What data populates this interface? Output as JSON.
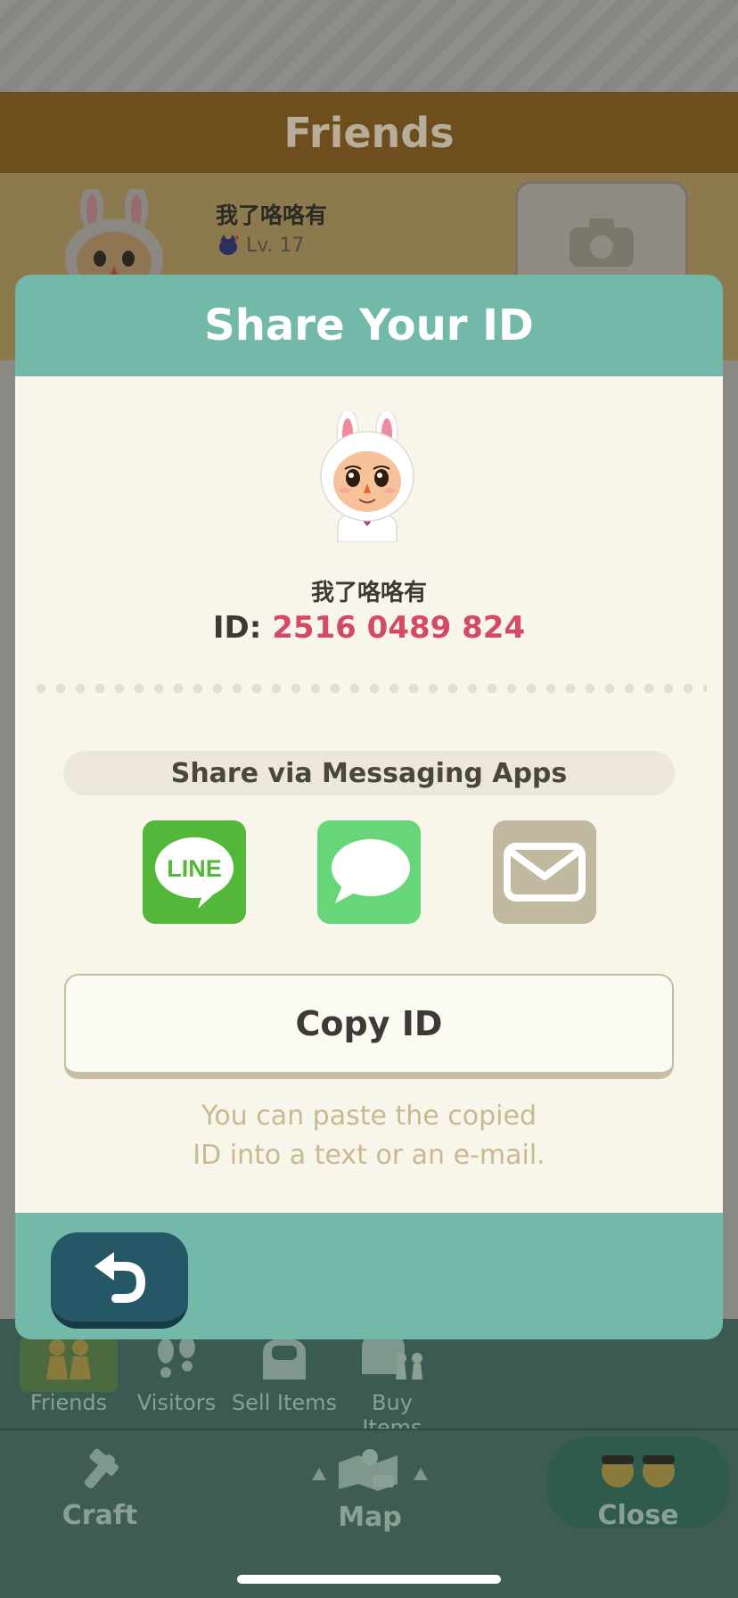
{
  "background": {
    "header_title": "Friends",
    "friend": {
      "name": "我了咯咯有",
      "level": "Lv. 17"
    },
    "tabs": [
      {
        "label": "Friends",
        "icon": "friends-icon",
        "active": true
      },
      {
        "label": "Visitors",
        "icon": "footprints-icon",
        "active": false
      },
      {
        "label": "Sell Items",
        "icon": "sell-box-icon",
        "active": false
      },
      {
        "label": "Buy Items",
        "icon": "buy-box-icon",
        "active": false
      }
    ],
    "bottom_nav": {
      "craft": "Craft",
      "map": "Map",
      "close": "Close"
    }
  },
  "modal": {
    "title": "Share Your ID",
    "player_name": "我了咯咯有",
    "id_label": "ID:",
    "id_value": "2516 0489 824",
    "share_via_label": "Share via Messaging Apps",
    "apps": [
      {
        "name": "LINE",
        "icon": "line-icon",
        "color": "#53b83a"
      },
      {
        "name": "Messages",
        "icon": "message-bubble-icon",
        "color": "#67d679"
      },
      {
        "name": "Mail",
        "icon": "mail-envelope-icon",
        "color": "#c0b99f"
      }
    ],
    "line_text": "LINE",
    "copy_button": "Copy ID",
    "hint_line1": "You can paste the copied",
    "hint_line2": "ID into a text or an e-mail."
  },
  "colors": {
    "modal_header": "#72b9a9",
    "modal_body": "#f8f6ea",
    "id_accent": "#d44a63",
    "back_button": "#265767"
  }
}
